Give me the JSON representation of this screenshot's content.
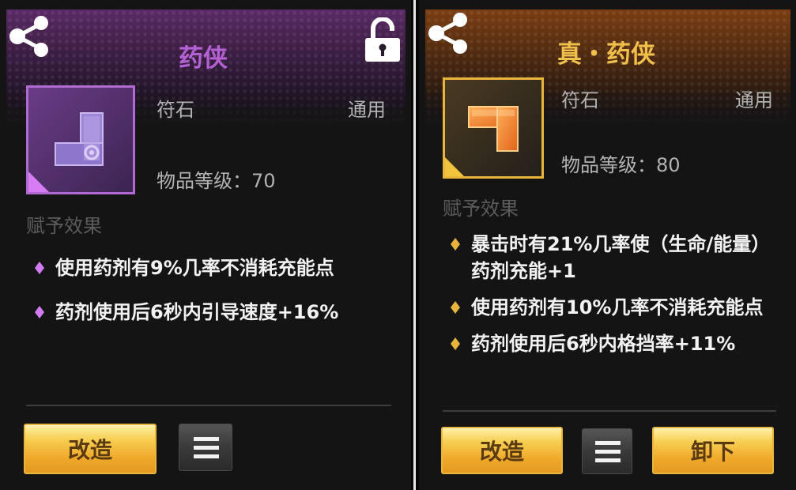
{
  "left": {
    "title": "药侠",
    "type": "符石",
    "slot": "通用",
    "level_label": "物品等级：70",
    "section_label": "赋予效果",
    "effects": [
      {
        "text": "使用药剂有9%几率不消耗充能点"
      },
      {
        "text": "药剂使用后6秒内引导速度+16%"
      }
    ],
    "modify_label": "改造",
    "colors": {
      "title": "#b561d6",
      "frame": "#b06ad2",
      "gem": "#d37af2"
    },
    "icons": [
      "share-icon",
      "unlock-icon",
      "menu-icon"
    ]
  },
  "right": {
    "title": "真・药侠",
    "type": "符石",
    "slot": "通用",
    "level_label": "物品等级：80",
    "section_label": "赋予效果",
    "effects": [
      {
        "text": "暴击时有21%几率使（生命/能量）药剂充能+1"
      },
      {
        "text": "使用药剂有10%几率不消耗充能点"
      },
      {
        "text": "药剂使用后6秒内格挡率+11%"
      }
    ],
    "modify_label": "改造",
    "unequip_label": "卸下",
    "colors": {
      "title": "#f0c04a",
      "frame": "#e8b63c",
      "gem": "#e9b33c"
    },
    "icons": [
      "share-icon",
      "menu-icon"
    ]
  }
}
